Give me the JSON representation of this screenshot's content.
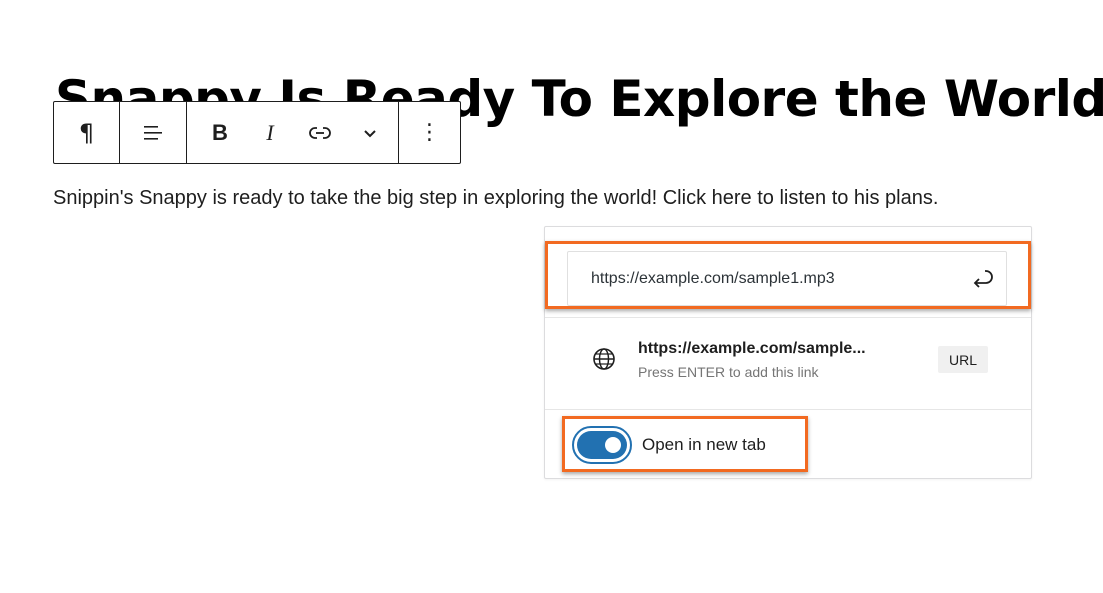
{
  "content": {
    "heading": "Snappy Is Ready To Explore the World",
    "paragraph": "Snippin's Snappy is ready to take the big step in exploring the world! Click here to listen to his plans."
  },
  "toolbar": {
    "paragraph_symbol": "¶",
    "bold": "B",
    "italic": "I",
    "more": "⋮"
  },
  "link_popover": {
    "url_value": "https://example.com/sample1.mp3",
    "suggestion_title": "https://example.com/sample...",
    "suggestion_hint": "Press ENTER to add this link",
    "suggestion_badge": "URL",
    "toggle_label": "Open in new tab",
    "toggle_checked": true
  },
  "colors": {
    "highlight": "#f26a21",
    "toggle_on": "#2271b1"
  }
}
